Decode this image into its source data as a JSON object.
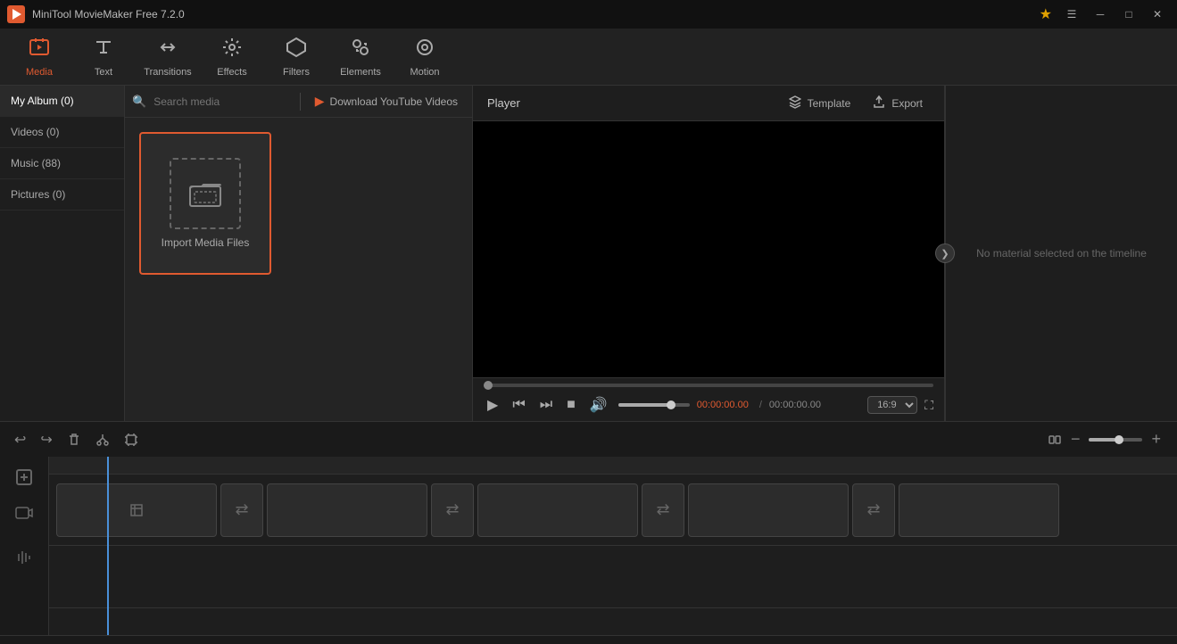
{
  "titlebar": {
    "title": "MiniTool MovieMaker Free 7.2.0",
    "star_icon": "★",
    "controls": {
      "menu": "☰",
      "minimize": "─",
      "maximize": "□",
      "close": "✕"
    }
  },
  "toolbar": {
    "items": [
      {
        "id": "media",
        "label": "Media",
        "icon": "📁",
        "active": true
      },
      {
        "id": "text",
        "label": "Text",
        "icon": "T"
      },
      {
        "id": "transitions",
        "label": "Transitions",
        "icon": "⇄"
      },
      {
        "id": "effects",
        "label": "Effects",
        "icon": "✨"
      },
      {
        "id": "filters",
        "label": "Filters",
        "icon": "⬡"
      },
      {
        "id": "elements",
        "label": "Elements",
        "icon": "⬖"
      },
      {
        "id": "motion",
        "label": "Motion",
        "icon": "◎"
      }
    ]
  },
  "sidebar": {
    "items": [
      {
        "id": "my-album",
        "label": "My Album (0)",
        "active": true
      },
      {
        "id": "videos",
        "label": "Videos (0)"
      },
      {
        "id": "music",
        "label": "Music (88)"
      },
      {
        "id": "pictures",
        "label": "Pictures (0)"
      }
    ]
  },
  "media": {
    "search_placeholder": "Search media",
    "yt_label": "Download YouTube Videos",
    "import_label": "Import Media Files"
  },
  "player": {
    "label": "Player",
    "template_label": "Template",
    "export_label": "Export",
    "time_current": "00:00:00.00",
    "time_separator": "/",
    "time_total": "00:00:00.00",
    "aspect_ratio": "16:9",
    "no_material": "No material selected on the timeline"
  },
  "timeline": {
    "undo_icon": "↩",
    "redo_icon": "↪",
    "delete_icon": "🗑",
    "cut_icon": "✂",
    "crop_icon": "⊡",
    "track_icons": [
      "➕",
      "🎬",
      "🎵"
    ],
    "zoom_minus": "−",
    "zoom_plus": "+"
  }
}
